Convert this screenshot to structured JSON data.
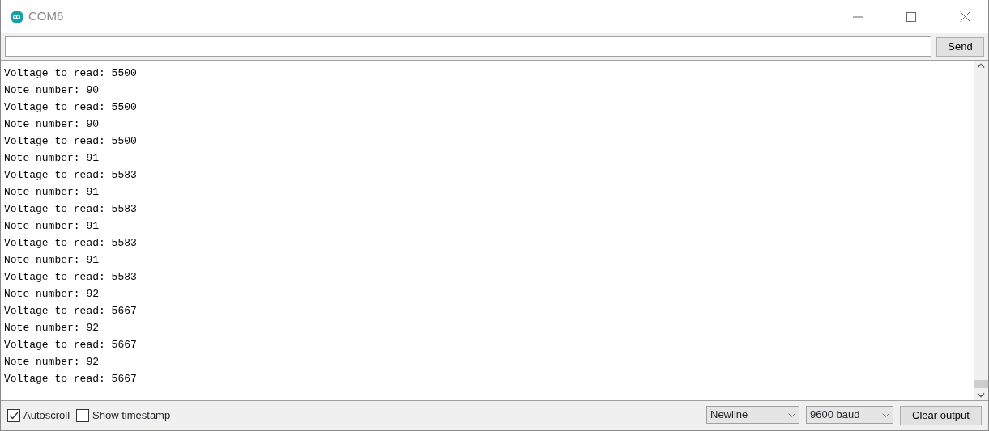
{
  "window": {
    "title": "COM6"
  },
  "send_button": "Send",
  "output_lines": [
    "Voltage to read: 5500",
    "Note number: 90",
    "Voltage to read: 5500",
    "Note number: 90",
    "Voltage to read: 5500",
    "Note number: 91",
    "Voltage to read: 5583",
    "Note number: 91",
    "Voltage to read: 5583",
    "Note number: 91",
    "Voltage to read: 5583",
    "Note number: 91",
    "Voltage to read: 5583",
    "Note number: 92",
    "Voltage to read: 5667",
    "Note number: 92",
    "Voltage to read: 5667",
    "Note number: 92",
    "Voltage to read: 5667"
  ],
  "checkboxes": [
    {
      "label": "Autoscroll",
      "checked": true
    },
    {
      "label": "Show timestamp",
      "checked": false
    }
  ],
  "line_ending": "Newline",
  "baud_rate": "9600 baud",
  "clear_button": "Clear output"
}
